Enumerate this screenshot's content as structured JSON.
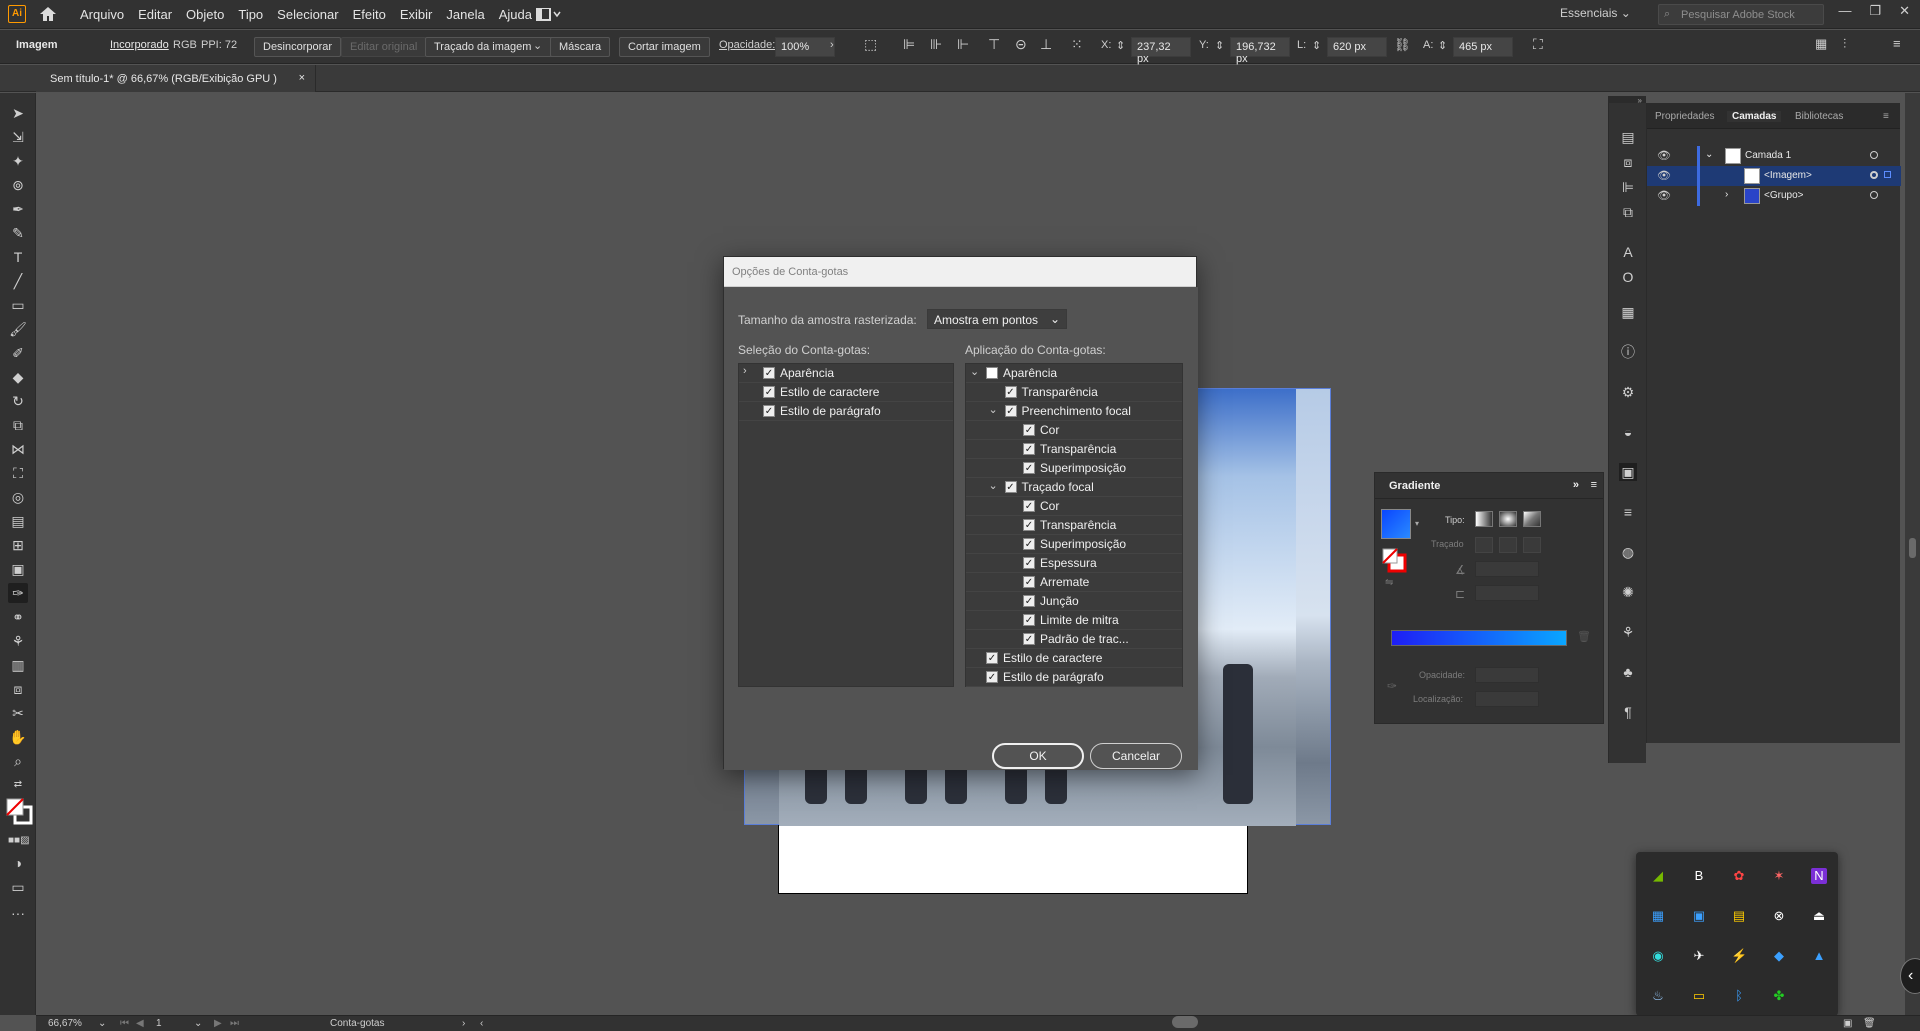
{
  "menubar": {
    "logo": "Ai",
    "items": [
      "Arquivo",
      "Editar",
      "Objeto",
      "Tipo",
      "Selecionar",
      "Efeito",
      "Exibir",
      "Janela",
      "Ajuda"
    ],
    "workspace": "Essenciais",
    "search_placeholder": "Pesquisar Adobe Stock",
    "window_controls": [
      "—",
      "❐",
      "✕"
    ]
  },
  "control_bar": {
    "object_type": "Imagem",
    "embedded": "Incorporado",
    "color_mode": "RGB",
    "ppi": "PPI: 72",
    "unembed": "Desincorporar",
    "edit_original": "Editar original",
    "image_trace": "Traçado da imagem",
    "mask": "Máscara",
    "crop": "Cortar imagem",
    "opacity_label": "Opacidade:",
    "opacity_value": "100%",
    "x_label": "X:",
    "x_value": "237,32 px",
    "y_label": "Y:",
    "y_value": "196,732 px",
    "w_label": "L:",
    "w_value": "620 px",
    "h_label": "A:",
    "h_value": "465 px"
  },
  "document_tab": {
    "title": "Sem título-1* @ 66,67% (RGB/Exibição GPU )",
    "close": "×"
  },
  "dialog": {
    "title": "Opções de Conta-gotas",
    "raster_label": "Tamanho da amostra rasterizada:",
    "raster_value": "Amostra em pontos",
    "pick_label": "Seleção do Conta-gotas:",
    "apply_label": "Aplicação do Conta-gotas:",
    "pick_items": [
      {
        "label": "Aparência",
        "checked": true,
        "twisty": "›"
      },
      {
        "label": "Estilo de caractere",
        "checked": true,
        "twisty": ""
      },
      {
        "label": "Estilo de parágrafo",
        "checked": true,
        "twisty": ""
      }
    ],
    "apply_items": [
      {
        "label": "Aparência",
        "checked": false,
        "twisty": "⌄",
        "indent": 0
      },
      {
        "label": "Transparência",
        "checked": true,
        "twisty": "",
        "indent": 1
      },
      {
        "label": "Preenchimento focal",
        "checked": true,
        "twisty": "⌄",
        "indent": 1
      },
      {
        "label": "Cor",
        "checked": true,
        "twisty": "",
        "indent": 2
      },
      {
        "label": "Transparência",
        "checked": true,
        "twisty": "",
        "indent": 2
      },
      {
        "label": "Superimposição",
        "checked": true,
        "twisty": "",
        "indent": 2
      },
      {
        "label": "Traçado focal",
        "checked": true,
        "twisty": "⌄",
        "indent": 1
      },
      {
        "label": "Cor",
        "checked": true,
        "twisty": "",
        "indent": 2
      },
      {
        "label": "Transparência",
        "checked": true,
        "twisty": "",
        "indent": 2
      },
      {
        "label": "Superimposição",
        "checked": true,
        "twisty": "",
        "indent": 2
      },
      {
        "label": "Espessura",
        "checked": true,
        "twisty": "",
        "indent": 2
      },
      {
        "label": "Arremate",
        "checked": true,
        "twisty": "",
        "indent": 2
      },
      {
        "label": "Junção",
        "checked": true,
        "twisty": "",
        "indent": 2
      },
      {
        "label": "Limite de mitra",
        "checked": true,
        "twisty": "",
        "indent": 2
      },
      {
        "label": "Padrão de trac...",
        "checked": true,
        "twisty": "",
        "indent": 2
      },
      {
        "label": "Estilo de caractere",
        "checked": true,
        "twisty": "",
        "indent": 0
      },
      {
        "label": "Estilo de parágrafo",
        "checked": true,
        "twisty": "",
        "indent": 0
      }
    ],
    "ok": "OK",
    "cancel": "Cancelar"
  },
  "layers_panel": {
    "tabs": [
      "Propriedades",
      "Camadas",
      "Bibliotecas"
    ],
    "active_tab": "Camadas",
    "layers": [
      {
        "name": "Camada 1"
      },
      {
        "name": "<Imagem>"
      },
      {
        "name": "<Grupo>"
      }
    ]
  },
  "gradient_panel": {
    "title": "Gradiente",
    "type_label": "Tipo:",
    "stroke_label": "Traçado",
    "opacity_label": "Opacidade:",
    "location_label": "Localização:",
    "gradient_start": "#1e1ef5",
    "gradient_end": "#0aa6ff"
  },
  "status_bar": {
    "zoom": "66,67%",
    "artboard": "1",
    "tool": "Conta-gotas"
  }
}
